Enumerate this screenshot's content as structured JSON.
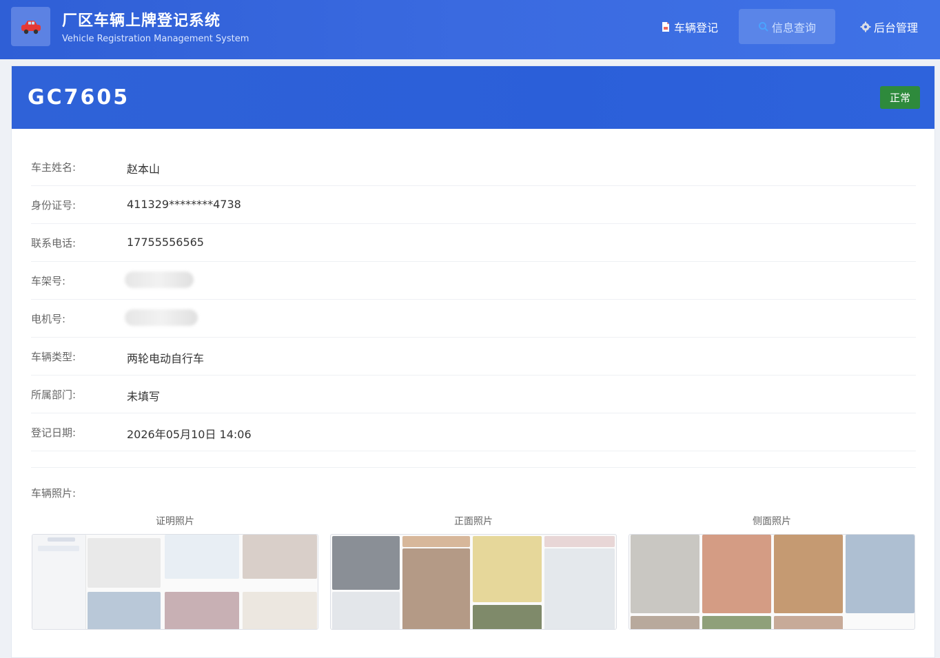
{
  "header": {
    "title": "厂区车辆上牌登记系统",
    "subtitle": "Vehicle Registration Management System",
    "nav": [
      {
        "label": "车辆登记",
        "icon": "document-icon"
      },
      {
        "label": "信息查询",
        "icon": "search-icon"
      },
      {
        "label": "后台管理",
        "icon": "gear-icon"
      }
    ]
  },
  "vehicle": {
    "plate": "GC7605",
    "status": "正常",
    "fields": [
      {
        "label": "车主姓名:",
        "value": "赵本山"
      },
      {
        "label": "身份证号:",
        "value": "411329********4738"
      },
      {
        "label": "联系电话:",
        "value": "17755556565"
      },
      {
        "label": "车架号:",
        "value": ""
      },
      {
        "label": "电机号:",
        "value": ""
      },
      {
        "label": "车辆类型:",
        "value": "两轮电动自行车"
      },
      {
        "label": "所属部门:",
        "value": "未填写"
      },
      {
        "label": "登记日期:",
        "value": "2026年05月10日 14:06"
      }
    ],
    "photos_label": "车辆照片:",
    "photos": [
      {
        "caption": "证明照片"
      },
      {
        "caption": "正面照片"
      },
      {
        "caption": "侧面照片"
      }
    ]
  },
  "colors": {
    "primary": "#2f5fd6",
    "status_ok": "#2e8a3c"
  }
}
